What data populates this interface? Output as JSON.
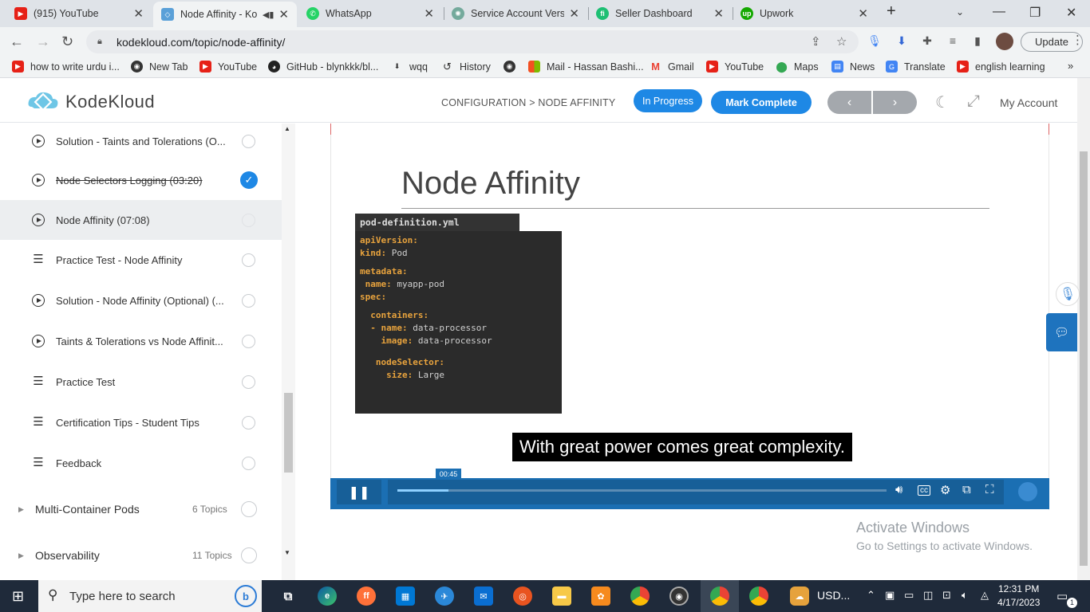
{
  "browser": {
    "tabs": [
      {
        "title": "(915) YouTube",
        "favicon": "youtube-icon",
        "active": false
      },
      {
        "title": "Node Affinity - Ko",
        "favicon": "kodekloud-icon",
        "active": true
      },
      {
        "title": "WhatsApp",
        "favicon": "whatsapp-icon",
        "active": false
      },
      {
        "title": "Service Account Versic",
        "favicon": "openai-icon",
        "active": false
      },
      {
        "title": "Seller Dashboard",
        "favicon": "fiverr-icon",
        "active": false
      },
      {
        "title": "Upwork",
        "favicon": "upwork-icon",
        "active": false
      }
    ],
    "url": "kodekloud.com/topic/node-affinity/",
    "update_label": "Update",
    "bookmarks": [
      {
        "label": "how to write urdu i...",
        "icon": "youtube-icon"
      },
      {
        "label": "New Tab",
        "icon": "globe-icon"
      },
      {
        "label": "YouTube",
        "icon": "youtube-icon"
      },
      {
        "label": "GitHub - blynkkk/bl...",
        "icon": "github-icon"
      },
      {
        "label": "wqq",
        "icon": "download-icon"
      },
      {
        "label": "History",
        "icon": "history-icon"
      },
      {
        "label": "",
        "icon": "globe-icon"
      },
      {
        "label": "Mail - Hassan Bashi...",
        "icon": "microsoft-icon"
      },
      {
        "label": "Gmail",
        "icon": "gmail-icon"
      },
      {
        "label": "YouTube",
        "icon": "youtube-icon"
      },
      {
        "label": "Maps",
        "icon": "maps-icon"
      },
      {
        "label": "News",
        "icon": "news-icon"
      },
      {
        "label": "Translate",
        "icon": "translate-icon"
      },
      {
        "label": "english learning",
        "icon": "youtube-icon"
      }
    ]
  },
  "site": {
    "logo_text": "KodeKloud",
    "breadcrumb": "CONFIGURATION > NODE AFFINITY",
    "in_progress_label": "In Progress",
    "mark_complete_label": "Mark Complete",
    "my_account_label": "My Account",
    "colors": {
      "accent": "#1e88e5",
      "player": "#1b6fb3"
    }
  },
  "sidebar": {
    "lessons": [
      {
        "title": "Solution - Taints and Tolerations (O...",
        "type": "video",
        "status": "incomplete"
      },
      {
        "title": "Node Selectors Logging (03:20)",
        "type": "video",
        "status": "complete"
      },
      {
        "title": "Node Affinity (07:08)",
        "type": "video",
        "status": "current"
      },
      {
        "title": "Practice Test - Node Affinity",
        "type": "lab",
        "status": "incomplete"
      },
      {
        "title": "Solution - Node Affinity (Optional) (...",
        "type": "video",
        "status": "incomplete"
      },
      {
        "title": "Taints & Tolerations vs Node Affinit...",
        "type": "video",
        "status": "incomplete"
      },
      {
        "title": "Practice Test",
        "type": "lab",
        "status": "incomplete"
      },
      {
        "title": "Certification Tips - Student Tips",
        "type": "lab",
        "status": "incomplete"
      },
      {
        "title": "Feedback",
        "type": "lab",
        "status": "incomplete"
      }
    ],
    "sections": [
      {
        "title": "Multi-Container Pods",
        "count": "6 Topics"
      },
      {
        "title": "Observability",
        "count": "11 Topics"
      }
    ]
  },
  "video": {
    "slide_title": "Node Affinity",
    "code_filename": "pod-definition.yml",
    "code_lines": [
      {
        "key": "apiVersion:",
        "val": ""
      },
      {
        "key": "kind:",
        "val": " Pod"
      },
      {
        "key": "metadata:",
        "val": ""
      },
      {
        "key": " name:",
        "val": " myapp-pod"
      },
      {
        "key": "spec:",
        "val": ""
      },
      {
        "key": "  containers:",
        "val": ""
      },
      {
        "key": "  - name:",
        "val": " data-processor"
      },
      {
        "key": "    image:",
        "val": " data-processor"
      },
      {
        "key": "   nodeSelector:",
        "val": ""
      },
      {
        "key": "     size:",
        "val": " Large"
      }
    ],
    "caption": "With great power comes great complexity.",
    "current_time": "00:45",
    "progress_fraction": 0.105
  },
  "watermark": {
    "line1": "Activate Windows",
    "line2": "Go to Settings to activate Windows."
  },
  "taskbar": {
    "search_placeholder": "Type here to search",
    "weather_text": "USD...",
    "time": "12:31 PM",
    "date": "4/17/2023",
    "notification_count": "1"
  }
}
